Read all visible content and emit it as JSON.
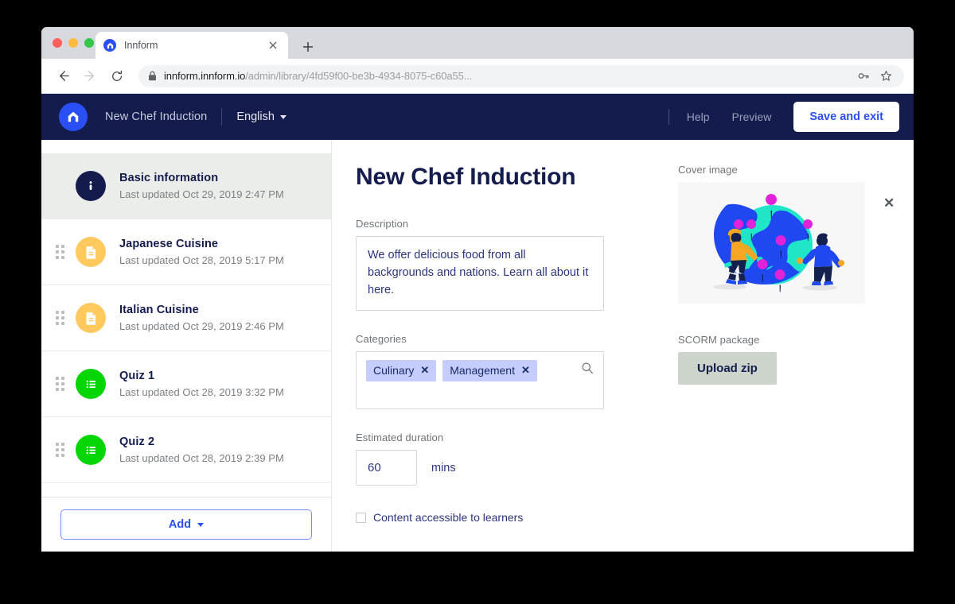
{
  "browser": {
    "tab": {
      "title": "Innform",
      "favicon_icon": "innform-logo-icon",
      "close_icon": "close-icon"
    },
    "new_tab_icon": "plus-icon",
    "nav": {
      "back_icon": "arrow-left-icon",
      "forward_icon": "arrow-right-icon",
      "reload_icon": "reload-icon"
    },
    "omnibox": {
      "lock_icon": "lock-icon",
      "url_domain": "innform.innform.io",
      "url_path": "/admin/library/4fd59f00-be3b-4934-8075-c60a55...",
      "key_icon": "key-icon",
      "bookmark_icon": "star-icon"
    }
  },
  "header": {
    "logo_icon": "innform-home-logo-icon",
    "course_name": "New Chef Induction",
    "language": "English",
    "language_caret_icon": "chevron-down-icon",
    "help_label": "Help",
    "preview_label": "Preview",
    "save_exit_label": "Save and exit"
  },
  "sidebar": {
    "modules": [
      {
        "title": "Basic information",
        "subtitle": "Last updated Oct 29, 2019 2:47 PM",
        "icon": "info-circle-icon",
        "icon_type": "info",
        "selected": true,
        "draggable": false
      },
      {
        "title": "Japanese Cuisine",
        "subtitle": "Last updated Oct 28, 2019 5:17 PM",
        "icon": "document-icon",
        "icon_type": "doc",
        "selected": false,
        "draggable": true
      },
      {
        "title": "Italian Cuisine",
        "subtitle": "Last updated Oct 29, 2019 2:46 PM",
        "icon": "document-icon",
        "icon_type": "doc",
        "selected": false,
        "draggable": true
      },
      {
        "title": "Quiz 1",
        "subtitle": "Last updated Oct 28, 2019 3:32 PM",
        "icon": "quiz-list-icon",
        "icon_type": "quiz",
        "selected": false,
        "draggable": true
      },
      {
        "title": "Quiz 2",
        "subtitle": "Last updated Oct 28, 2019 2:39 PM",
        "icon": "quiz-list-icon",
        "icon_type": "quiz",
        "selected": false,
        "draggable": true
      }
    ],
    "add_button_label": "Add",
    "add_button_caret_icon": "chevron-down-icon"
  },
  "main": {
    "page_title": "New Chef Induction",
    "description": {
      "label": "Description",
      "value": "We offer delicious food from all backgrounds and nations. Learn all about it here."
    },
    "categories": {
      "label": "Categories",
      "chips": [
        "Culinary",
        "Management"
      ],
      "chip_remove_icon": "close-small-icon",
      "search_icon": "search-icon"
    },
    "duration": {
      "label": "Estimated duration",
      "value": "60",
      "unit": "mins"
    },
    "accessible": {
      "label": "Content accessible to learners",
      "checked": false
    },
    "cover_image": {
      "label": "Cover image",
      "alt": "two people placing pins on a globe illustration",
      "remove_icon": "close-icon"
    },
    "scorm": {
      "label": "SCORM package",
      "upload_button_label": "Upload zip"
    }
  },
  "colors": {
    "brand_navy": "#141b4d",
    "brand_blue": "#2a4ff5",
    "doc_yellow": "#ffc95e",
    "quiz_green": "#06d506",
    "chip_bg": "#c4cdfb",
    "selected_row_bg": "#ebedea",
    "upload_button_bg": "#ccd4cc"
  }
}
